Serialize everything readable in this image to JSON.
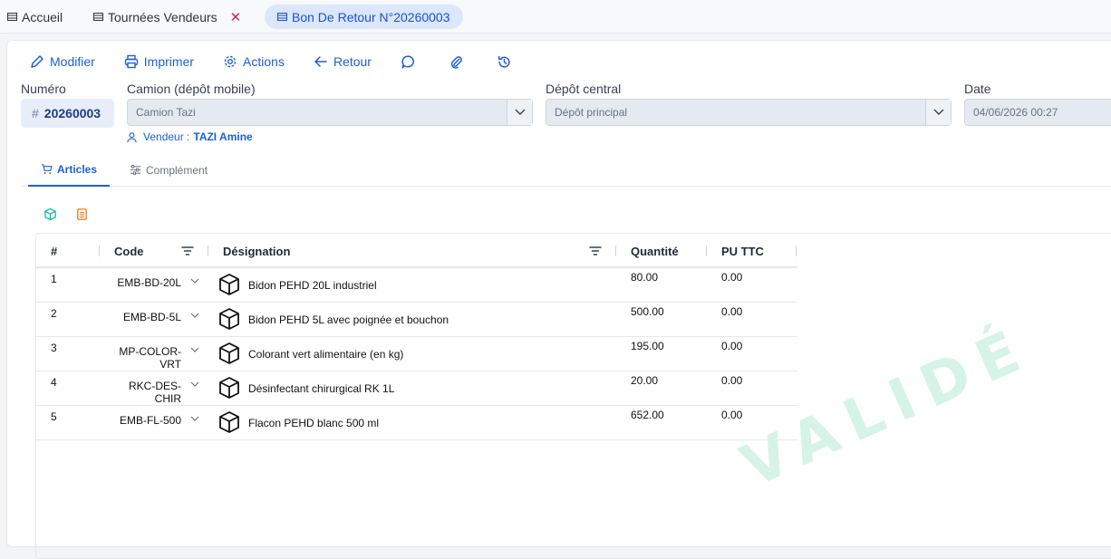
{
  "tabs": [
    {
      "label": "Accueil",
      "closable": false,
      "active": false
    },
    {
      "label": "Tournées Vendeurs",
      "closable": true,
      "active": false
    },
    {
      "label": "Bon De Retour N°20260003",
      "closable": false,
      "active": true
    }
  ],
  "toolbar": {
    "modifier": "Modifier",
    "imprimer": "Imprimer",
    "actions": "Actions",
    "retour": "Retour"
  },
  "form": {
    "numero_label": "Numéro",
    "numero_value": "20260003",
    "camion_label": "Camion (dépôt mobile)",
    "camion_value": "Camion Tazi",
    "depot_label": "Dépôt central",
    "depot_value": "Dépôt principal",
    "date_label": "Date",
    "date_value": "04/06/2026 00:27",
    "vendeur_label": "Vendeur :",
    "vendeur_value": "TAZI Amine"
  },
  "subtabs": {
    "articles": "Articles",
    "complement": "Complément"
  },
  "grid": {
    "columns": [
      "#",
      "Code",
      "Désignation",
      "Quantité",
      "PU TTC"
    ],
    "rows": [
      {
        "num": "1",
        "code": "EMB-BD-20L",
        "designation": "Bidon PEHD 20L industriel",
        "quantite": "80.00",
        "pu": "0.00"
      },
      {
        "num": "2",
        "code": "EMB-BD-5L",
        "designation": "Bidon PEHD 5L avec poignée et bouchon",
        "quantite": "500.00",
        "pu": "0.00"
      },
      {
        "num": "3",
        "code": "MP-COLOR-VRT",
        "designation": "Colorant vert alimentaire (en kg)",
        "quantite": "195.00",
        "pu": "0.00"
      },
      {
        "num": "4",
        "code": "RKC-DES-CHIR",
        "designation": "Désinfectant chirurgical RK 1L",
        "quantite": "20.00",
        "pu": "0.00"
      },
      {
        "num": "5",
        "code": "EMB-FL-500",
        "designation": "Flacon PEHD blanc 500 ml",
        "quantite": "652.00",
        "pu": "0.00"
      }
    ]
  },
  "status_watermark": "VALIDÉ",
  "colors": {
    "accent": "#1d5fd1",
    "watermark": "#d6f3e8",
    "close": "#e11d48"
  }
}
